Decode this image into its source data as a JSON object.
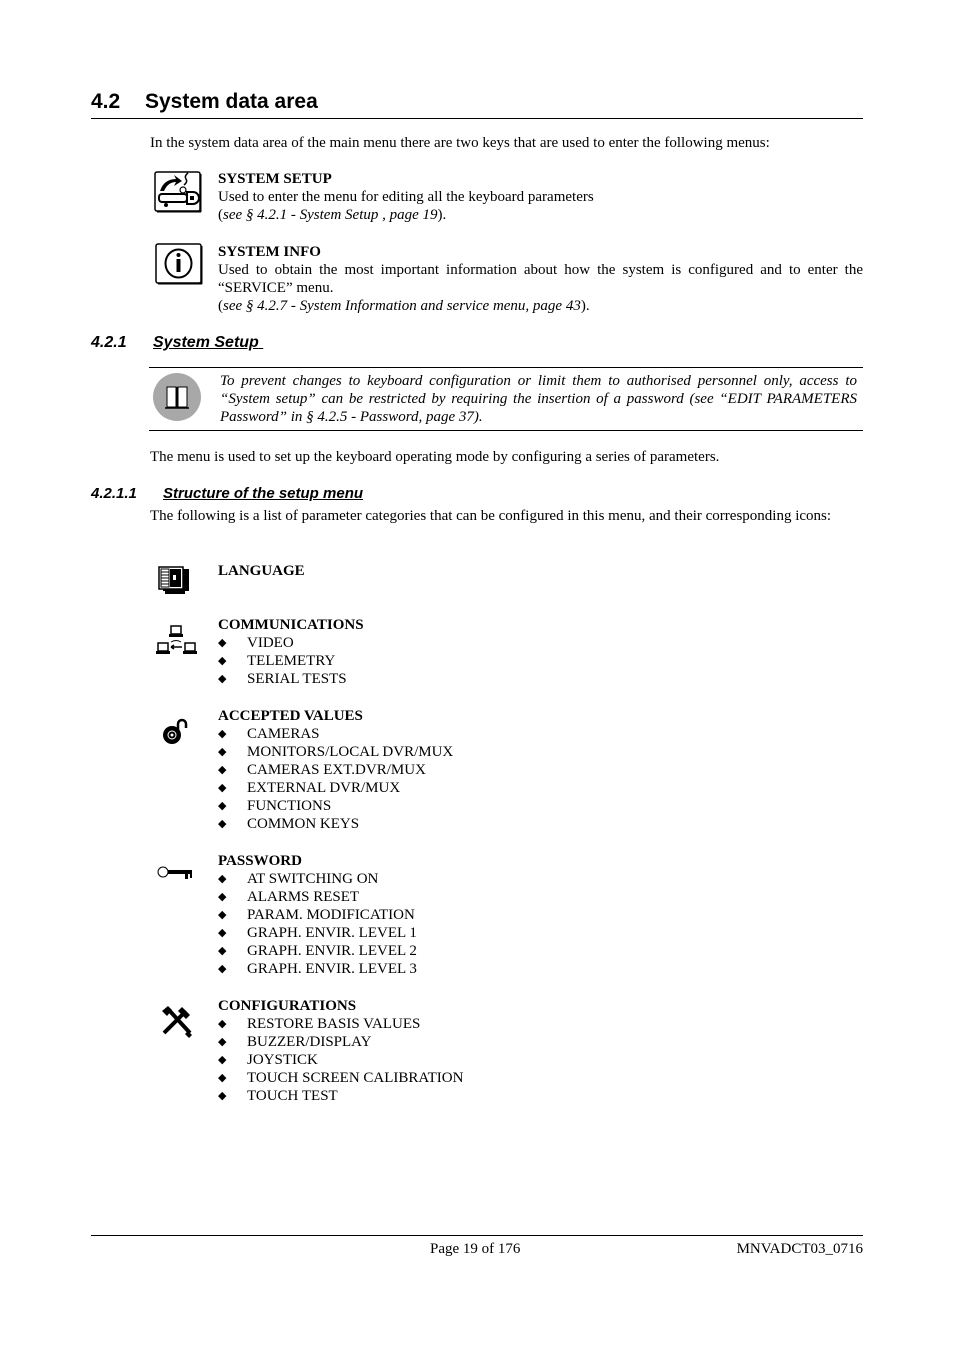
{
  "section": {
    "number": "4.2",
    "title": "System data area",
    "intro": "In the system data area of the main menu there are two keys that are used to enter the following menus:"
  },
  "keys": [
    {
      "icon": "system-setup-icon",
      "title": "SYSTEM SETUP",
      "description": "Used to enter the menu for editing all the keyboard parameters",
      "ref_open": "(",
      "ref": "see § 4.2.1 - System Setup , page 19",
      "ref_close": ")."
    },
    {
      "icon": "info-icon",
      "title": "SYSTEM INFO",
      "description": "Used to obtain the most important information about how the system is configured and to enter the “SERVICE” menu.",
      "ref_open": "(",
      "ref": "see § 4.2.7 - System Information and service menu, page 43",
      "ref_close": ")."
    }
  ],
  "subsection": {
    "number": "4.2.1",
    "title": "System Setup",
    "note_icon": "book-icon",
    "note": "To prevent changes to keyboard configuration or limit them to authorised personnel only, access to “System setup” can be restricted by requiring the insertion of a password (see “EDIT PARAMETERS Password” in § 4.2.5 - Password, page 37).",
    "body": "The menu is used to set up the keyboard operating mode by configuring a series of parameters."
  },
  "subsubsection": {
    "number": "4.2.1.1",
    "title": "Structure of the setup menu",
    "intro": "The following is a list of parameter categories that can be configured in this menu, and their corresponding icons:"
  },
  "categories": [
    {
      "icon": "language-icon",
      "title": "LANGUAGE",
      "items": []
    },
    {
      "icon": "network-icon",
      "title": "COMMUNICATIONS",
      "items": [
        "VIDEO",
        "TELEMETRY",
        "SERIAL TESTS"
      ]
    },
    {
      "icon": "padlock-open-icon",
      "title": "ACCEPTED VALUES",
      "items": [
        "CAMERAS",
        "MONITORS/LOCAL DVR/MUX",
        "CAMERAS EXT.DVR/MUX",
        "EXTERNAL DVR/MUX",
        "FUNCTIONS",
        "COMMON KEYS"
      ]
    },
    {
      "icon": "key-icon",
      "title": "PASSWORD",
      "items": [
        "AT SWITCHING ON",
        "ALARMS RESET",
        "PARAM. MODIFICATION",
        "GRAPH. ENVIR. LEVEL 1",
        "GRAPH. ENVIR. LEVEL 2",
        "GRAPH. ENVIR. LEVEL 3"
      ]
    },
    {
      "icon": "tools-icon",
      "title": "CONFIGURATIONS",
      "items": [
        "RESTORE BASIS VALUES",
        "BUZZER/DISPLAY",
        "JOYSTICK",
        "TOUCH SCREEN CALIBRATION",
        "TOUCH TEST"
      ]
    }
  ],
  "bullet": "◆",
  "footer": {
    "page": "Page 19 of 176",
    "doc_code": "MNVADCT03_0716"
  },
  "colors": {
    "note_icon_bg": "#a8a8a8",
    "text": "#000000"
  }
}
